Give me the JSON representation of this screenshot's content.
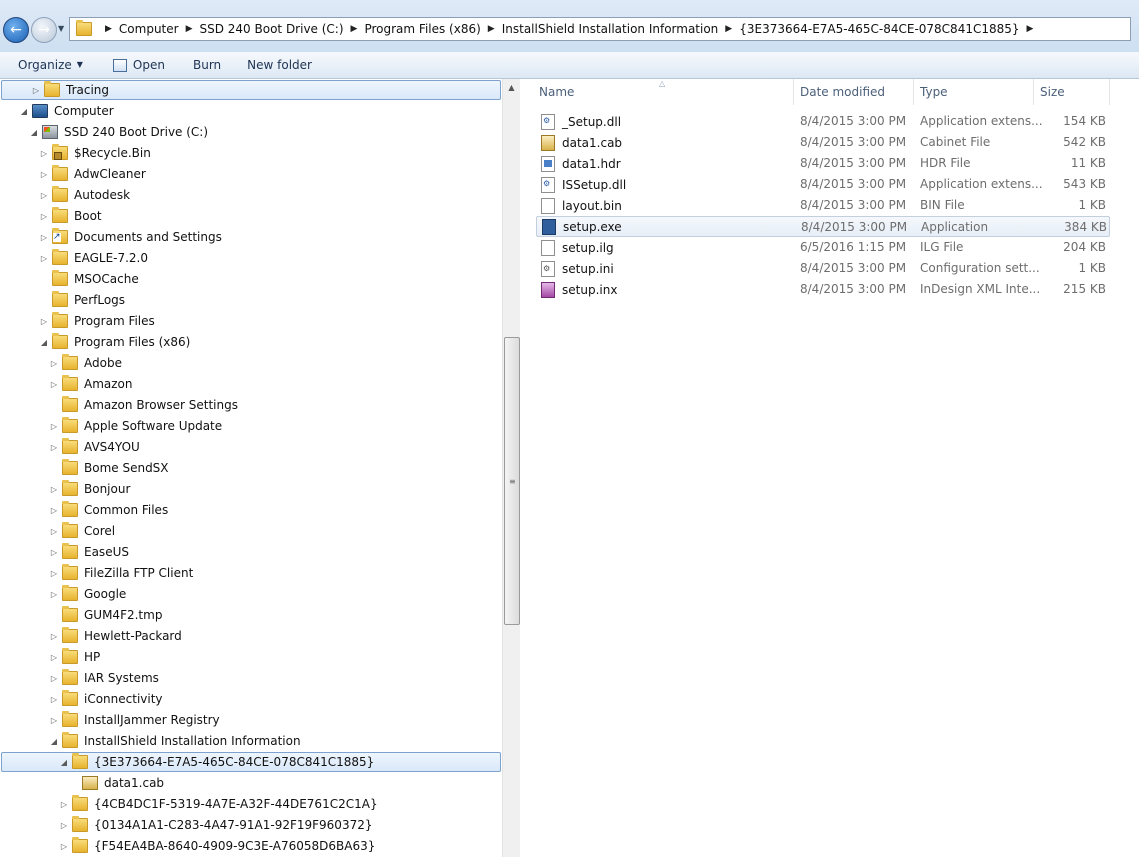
{
  "address_bar": {
    "crumbs": [
      "Computer",
      "SSD 240 Boot Drive (C:)",
      "Program Files (x86)",
      "InstallShield Installation Information",
      "{3E373664-E7A5-465C-84CE-078C841C1885}"
    ]
  },
  "toolbar": {
    "organize": "Organize",
    "open": "Open",
    "burn": "Burn",
    "new_folder": "New folder"
  },
  "tree": [
    {
      "label": "Tracing"
    },
    {
      "label": "Computer"
    },
    {
      "label": "SSD 240 Boot Drive (C:)"
    },
    {
      "label": "$Recycle.Bin"
    },
    {
      "label": "AdwCleaner"
    },
    {
      "label": "Autodesk"
    },
    {
      "label": "Boot"
    },
    {
      "label": "Documents and Settings"
    },
    {
      "label": "EAGLE-7.2.0"
    },
    {
      "label": "MSOCache"
    },
    {
      "label": "PerfLogs"
    },
    {
      "label": "Program Files"
    },
    {
      "label": "Program Files (x86)"
    },
    {
      "label": "Adobe"
    },
    {
      "label": "Amazon"
    },
    {
      "label": "Amazon Browser Settings"
    },
    {
      "label": "Apple Software Update"
    },
    {
      "label": "AVS4YOU"
    },
    {
      "label": "Bome SendSX"
    },
    {
      "label": "Bonjour"
    },
    {
      "label": "Common Files"
    },
    {
      "label": "Corel"
    },
    {
      "label": "EaseUS"
    },
    {
      "label": "FileZilla FTP Client"
    },
    {
      "label": "Google"
    },
    {
      "label": "GUM4F2.tmp"
    },
    {
      "label": "Hewlett-Packard"
    },
    {
      "label": "HP"
    },
    {
      "label": "IAR Systems"
    },
    {
      "label": "iConnectivity"
    },
    {
      "label": "InstallJammer Registry"
    },
    {
      "label": "InstallShield Installation Information"
    },
    {
      "label": "{3E373664-E7A5-465C-84CE-078C841C1885}"
    },
    {
      "label": "data1.cab"
    },
    {
      "label": "{4CB4DC1F-5319-4A7E-A32F-44DE761C2C1A}"
    },
    {
      "label": "{0134A1A1-C283-4A47-91A1-92F19F960372}"
    },
    {
      "label": "{F54EA4BA-8640-4909-9C3E-A76058D6BA63}"
    }
  ],
  "columns": {
    "name": "Name",
    "date": "Date modified",
    "type": "Type",
    "size": "Size"
  },
  "files": [
    {
      "name": "_Setup.dll",
      "date": "8/4/2015 3:00 PM",
      "type": "Application extens...",
      "size": "154 KB",
      "icon": "dll-icon"
    },
    {
      "name": "data1.cab",
      "date": "8/4/2015 3:00 PM",
      "type": "Cabinet File",
      "size": "542 KB",
      "icon": "cab-icon"
    },
    {
      "name": "data1.hdr",
      "date": "8/4/2015 3:00 PM",
      "type": "HDR File",
      "size": "11 KB",
      "icon": "hdr-icon"
    },
    {
      "name": "ISSetup.dll",
      "date": "8/4/2015 3:00 PM",
      "type": "Application extens...",
      "size": "543 KB",
      "icon": "dll-icon"
    },
    {
      "name": "layout.bin",
      "date": "8/4/2015 3:00 PM",
      "type": "BIN File",
      "size": "1 KB",
      "icon": "bin-icon"
    },
    {
      "name": "setup.exe",
      "date": "8/4/2015 3:00 PM",
      "type": "Application",
      "size": "384 KB",
      "icon": "exe-icon"
    },
    {
      "name": "setup.ilg",
      "date": "6/5/2016 1:15 PM",
      "type": "ILG File",
      "size": "204 KB",
      "icon": "ilg-icon"
    },
    {
      "name": "setup.ini",
      "date": "8/4/2015 3:00 PM",
      "type": "Configuration sett...",
      "size": "1 KB",
      "icon": "ini-icon"
    },
    {
      "name": "setup.inx",
      "date": "8/4/2015 3:00 PM",
      "type": "InDesign XML Inte...",
      "size": "215 KB",
      "icon": "inx-icon"
    }
  ],
  "colors": {
    "selection_border": "#7da2ce",
    "header_text": "#4c607a",
    "secondary_text": "#6d6d6d"
  }
}
